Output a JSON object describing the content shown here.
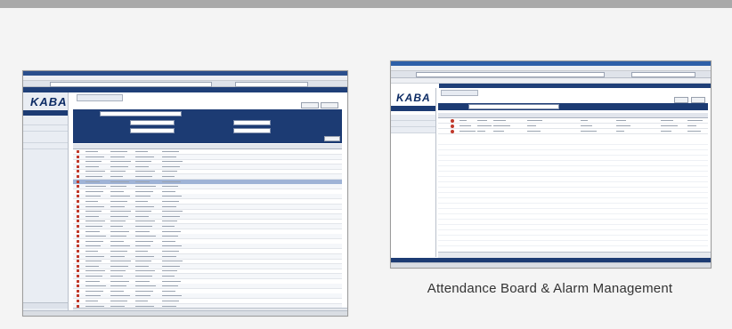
{
  "caption": "Attendance Board & Alarm Management",
  "left_screenshot": {
    "browser_title": "",
    "brand": "KABA",
    "tab": "",
    "rows": 32,
    "selected_row": 6
  },
  "right_screenshot": {
    "browser_title": "",
    "brand": "KABA",
    "rows": 3
  },
  "colors": {
    "navy": "#1c3b73",
    "titlebar": "#2a4e8c",
    "selection": "#9fb3d6",
    "alarm": "#c0392b"
  }
}
